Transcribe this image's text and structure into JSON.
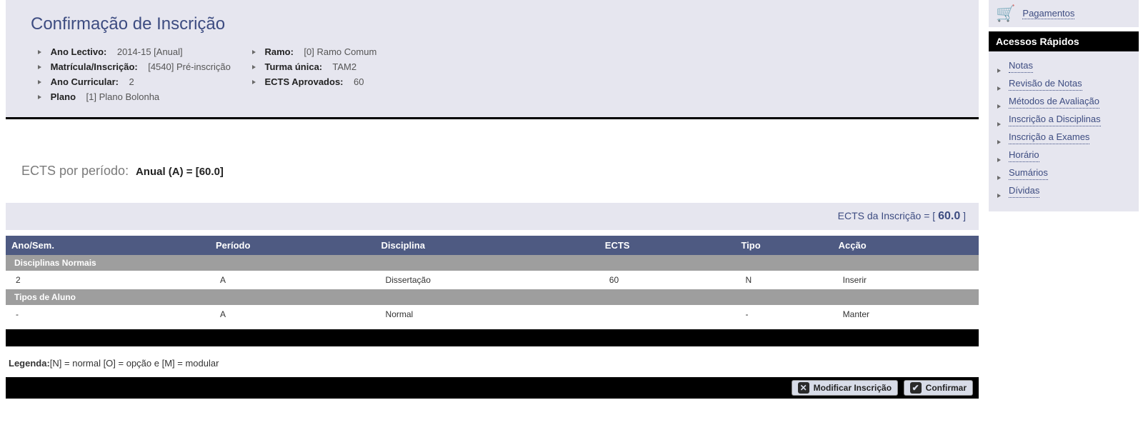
{
  "header": {
    "title": "Confirmação de Inscrição",
    "left": [
      {
        "label": "Ano Lectivo:",
        "value": "2014-15 [Anual]"
      },
      {
        "label": "Matrícula/Inscrição:",
        "value": "[4540] Pré-inscrição"
      },
      {
        "label": "Ano Curricular:",
        "value": "2"
      },
      {
        "label": "Plano",
        "value": "[1] Plano Bolonha"
      }
    ],
    "right": [
      {
        "label": "Ramo:",
        "value": "[0] Ramo Comum"
      },
      {
        "label": "Turma única:",
        "value": "TAM2"
      },
      {
        "label": "ECTS Aprovados:",
        "value": "60"
      }
    ]
  },
  "ects_period": {
    "label": "ECTS por período:",
    "value": "Anual (A) = [60.0]"
  },
  "ects_bar": {
    "label": "ECTS da Inscrição = [",
    "value": "60.0",
    "close": "]"
  },
  "table": {
    "headers": {
      "c0": "Ano/Sem.",
      "c1": "Período",
      "c2": "Disciplina",
      "c3": "ECTS",
      "c4": "Tipo",
      "c5": "Acção"
    },
    "group1": "Disciplinas Normais",
    "row1": {
      "c0": "2",
      "c1": "A",
      "c2": "Dissertação",
      "c3": "60",
      "c4": "N",
      "c5": "Inserir"
    },
    "group2": "Tipos de Aluno",
    "row2": {
      "c0": "-",
      "c1": "A",
      "c2": "Normal",
      "c3": "",
      "c4": "-",
      "c5": "Manter"
    }
  },
  "legend": {
    "label": "Legenda:",
    "text": "[N] = normal [O] = opção e [M] = modular"
  },
  "buttons": {
    "modify": "Modificar Inscrição",
    "confirm": "Confirmar"
  },
  "sidebar": {
    "pagamentos": "Pagamentos",
    "quick_title": "Acessos Rápidos",
    "links": {
      "l0": "Notas",
      "l1": "Revisão de Notas",
      "l2": "Métodos de Avaliação",
      "l3": "Inscrição a Disciplinas",
      "l4": "Inscrição a Exames",
      "l5": "Horário",
      "l6": "Sumários",
      "l7": "Dívidas"
    }
  }
}
